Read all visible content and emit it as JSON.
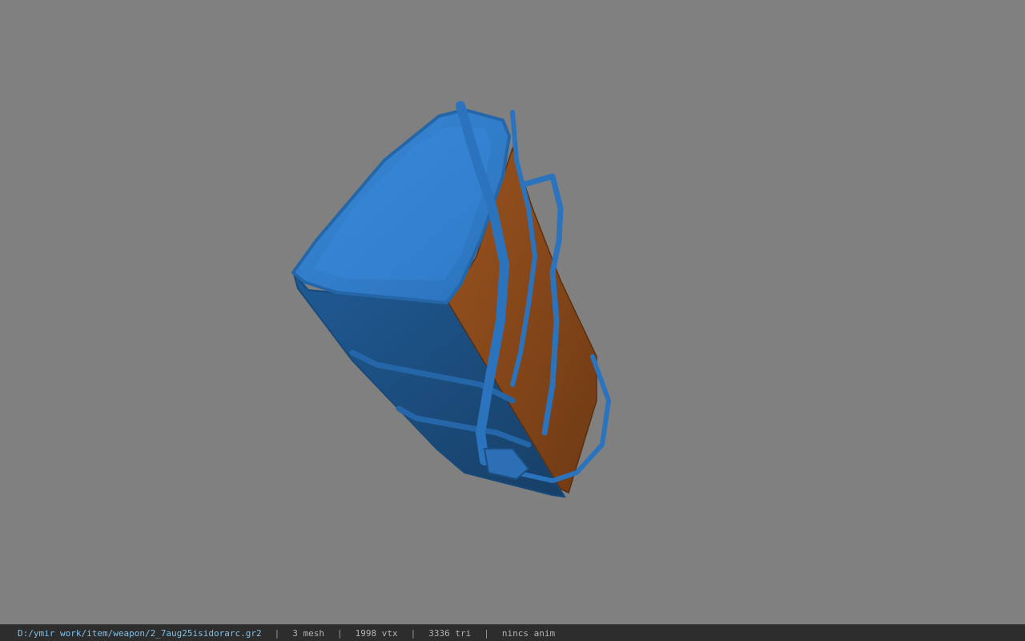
{
  "viewer": {
    "background_color": "#808080",
    "model_colors": {
      "leather_blue": "#2f7cc8",
      "leather_blue_dark": "#1f5588",
      "leather_side": "#1b4f84",
      "wood_brown": "#8a4a1b"
    }
  },
  "status": {
    "file_path": "D:/ymir work/item/weapon/2_7aug25isidorarc.gr2",
    "separator": "|",
    "mesh": "3 mesh",
    "vtx": "1998 vtx",
    "tri": "3336 tri",
    "anim": "nincs anim"
  }
}
